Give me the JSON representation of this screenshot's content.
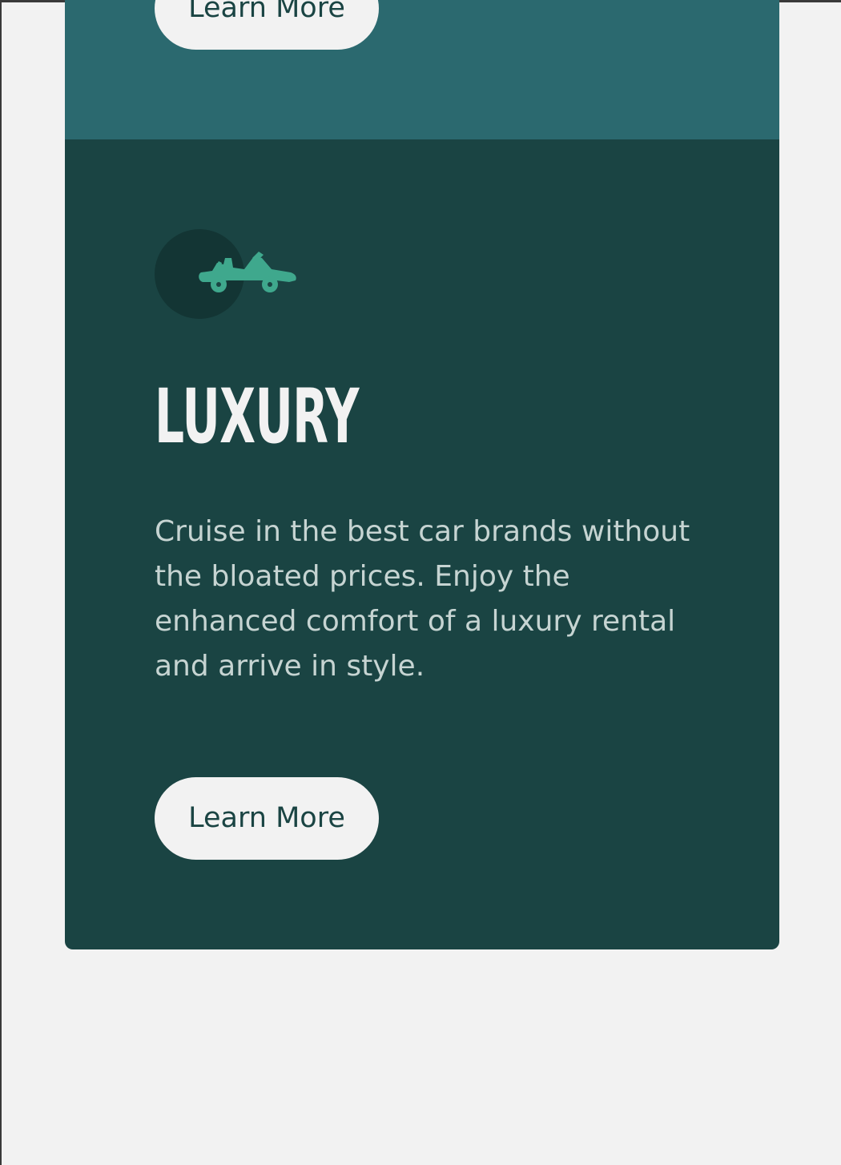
{
  "cards": {
    "suv": {
      "button_label": "Learn More",
      "background_color": "#2b696f"
    },
    "luxury": {
      "icon": "convertible-car-icon",
      "title": "LUXURY",
      "description": "Cruise in the best car brands without the bloated prices. Enjoy the enhanced comfort of a luxury rental and arrive in style.",
      "button_label": "Learn More",
      "background_color": "#1a4443",
      "icon_color": "#3fa88d"
    }
  },
  "colors": {
    "page_background": "#f2f2f2",
    "button_background": "#f2f2f2",
    "button_text": "#1a4443"
  }
}
